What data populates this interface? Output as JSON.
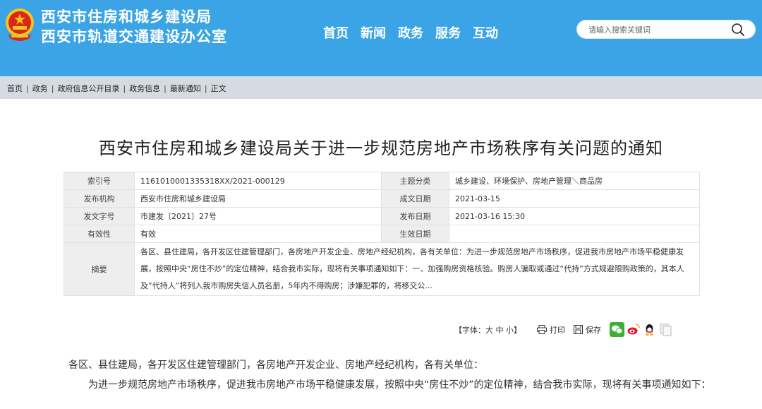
{
  "header": {
    "line1": "西安市住房和城乡建设局",
    "line2": "西安市轨道交通建设办公室",
    "nav": [
      "首页",
      "新闻",
      "政务",
      "服务",
      "互动"
    ],
    "search_placeholder": "请输入搜索关键词",
    "colors": {
      "bar": "#3aa4e6",
      "emblem_red": "#d9251c",
      "emblem_gold": "#f5c518"
    }
  },
  "breadcrumb": [
    "首页",
    "政务",
    "政府信息公开目录",
    "政务信息",
    "最新通知",
    "正文"
  ],
  "article": {
    "title": "西安市住房和城乡建设局关于进一步规范房地产市场秩序有关问题的通知",
    "info": {
      "index_label": "索引号",
      "index_value": "1161010001335318XX/2021-000129",
      "topic_label": "主题分类",
      "topic_value": "城乡建设、环境保护、房地产管理＼商品房",
      "org_label": "发布机构",
      "org_value": "西安市住房和城乡建设局",
      "created_label": "成文日期",
      "created_value": "2021-03-15",
      "docno_label": "发文字号",
      "docno_value": "市建发〔2021〕27号",
      "published_label": "发布日期",
      "published_value": "2021-03-16 15:30",
      "validity_label": "有效性",
      "validity_value": "有效",
      "effective_label": "生效日期",
      "effective_value": "",
      "abstract_label": "摘要",
      "abstract_value": "各区、县住建局，各开发区住建管理部门，各房地产开发企业、房地产经纪机构，各有关单位：为进一步规范房地产市场秩序，促进我市房地产市场平稳健康发展，按照中央“房住不炒”的定位精神，结合我市实际，现将有关事项通知如下：一、加强购房资格核验。购房人骗取或通过“代持”方式规避限购政策的，其本人及“代持人”将列入我市购房失信人员名册，5年内不得购房；涉嫌犯罪的，将移交公..."
    },
    "tools": {
      "font_size": "【字体：大 中 小】",
      "print": "打印",
      "save": "保存",
      "share_icons": [
        "wechat-icon",
        "weibo-icon",
        "qq-icon",
        "copy-icon"
      ],
      "share_colors": {
        "wechat": "#3cb034",
        "weibo": "#e6162d",
        "qq": "#1296db"
      }
    },
    "body": {
      "salutation": "各区、县住建局，各开发区住建管理部门，各房地产开发企业、房地产经纪机构，各有关单位：",
      "para1": "为进一步规范房地产市场秩序，促进我市房地产市场平稳健康发展，按照中央“房住不炒”的定位精神，结合我市实际，现将有关事项通知如下："
    }
  }
}
